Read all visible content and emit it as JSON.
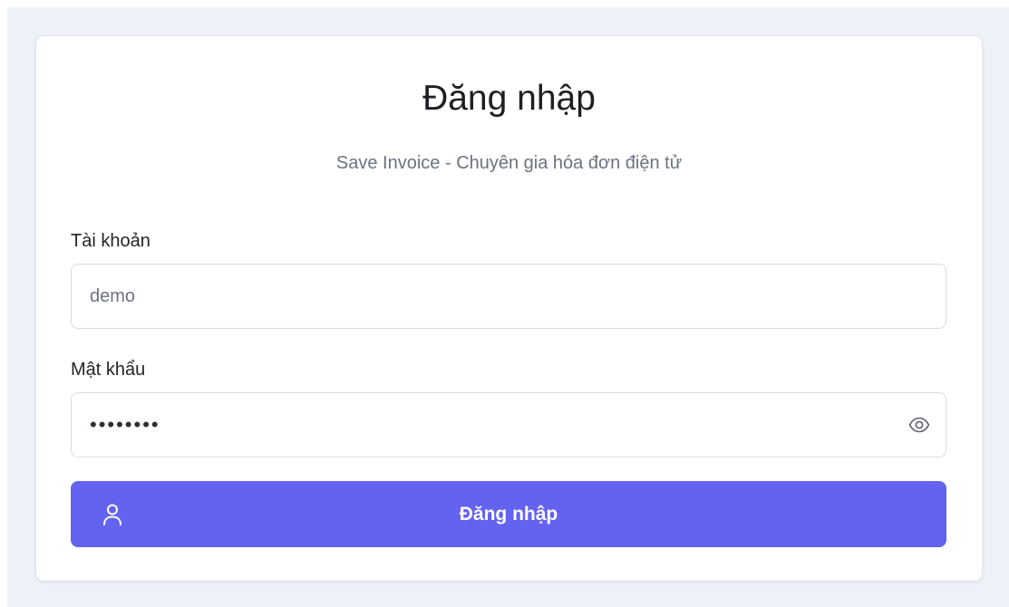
{
  "login": {
    "title": "Đăng nhập",
    "subtitle": "Save Invoice - Chuyên gia hóa đơn điện tử",
    "username_label": "Tài khoản",
    "username_value": "demo",
    "password_label": "Mật khẩu",
    "password_value": "demo1234",
    "submit_label": "Đăng nhập",
    "password_toggle_icon": "eye-icon",
    "submit_icon": "user-icon"
  },
  "colors": {
    "page_background": "#eef1f7",
    "card_background": "#ffffff",
    "primary_button": "#6463ef",
    "input_border": "#d9dce2"
  }
}
